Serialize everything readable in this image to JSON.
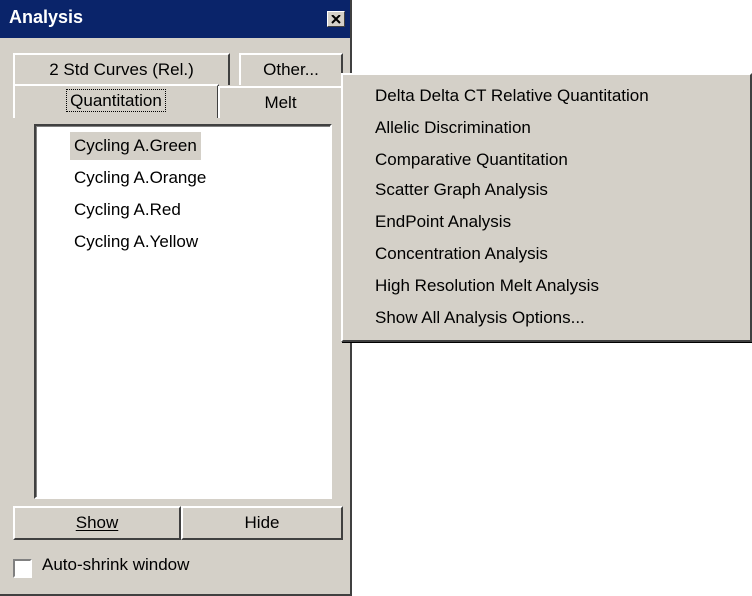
{
  "window": {
    "title": "Analysis"
  },
  "tabs": {
    "row1": [
      "2 Std Curves (Rel.)",
      "Other..."
    ],
    "row2": [
      "Quantitation",
      "Melt"
    ],
    "active": "Quantitation"
  },
  "channels": [
    {
      "label": "Cycling A.Green",
      "selected": true
    },
    {
      "label": "Cycling A.Orange",
      "selected": false
    },
    {
      "label": "Cycling A.Red",
      "selected": false
    },
    {
      "label": "Cycling A.Yellow",
      "selected": false
    }
  ],
  "buttons": {
    "show": "Show",
    "hide": "Hide"
  },
  "options": {
    "auto_shrink_label": "Auto-shrink window",
    "auto_shrink_checked": false
  },
  "context_menu": {
    "items": [
      "Delta Delta CT Relative Quantitation",
      "Allelic Discrimination",
      "Comparative Quantitation",
      "Scatter Graph Analysis",
      "EndPoint Analysis",
      "Concentration Analysis",
      "High Resolution Melt Analysis",
      "Show All Analysis Options..."
    ]
  },
  "colors": {
    "title_bar": "#0a246a",
    "face": "#d4d0c8",
    "selection": "#d4d0c8"
  }
}
